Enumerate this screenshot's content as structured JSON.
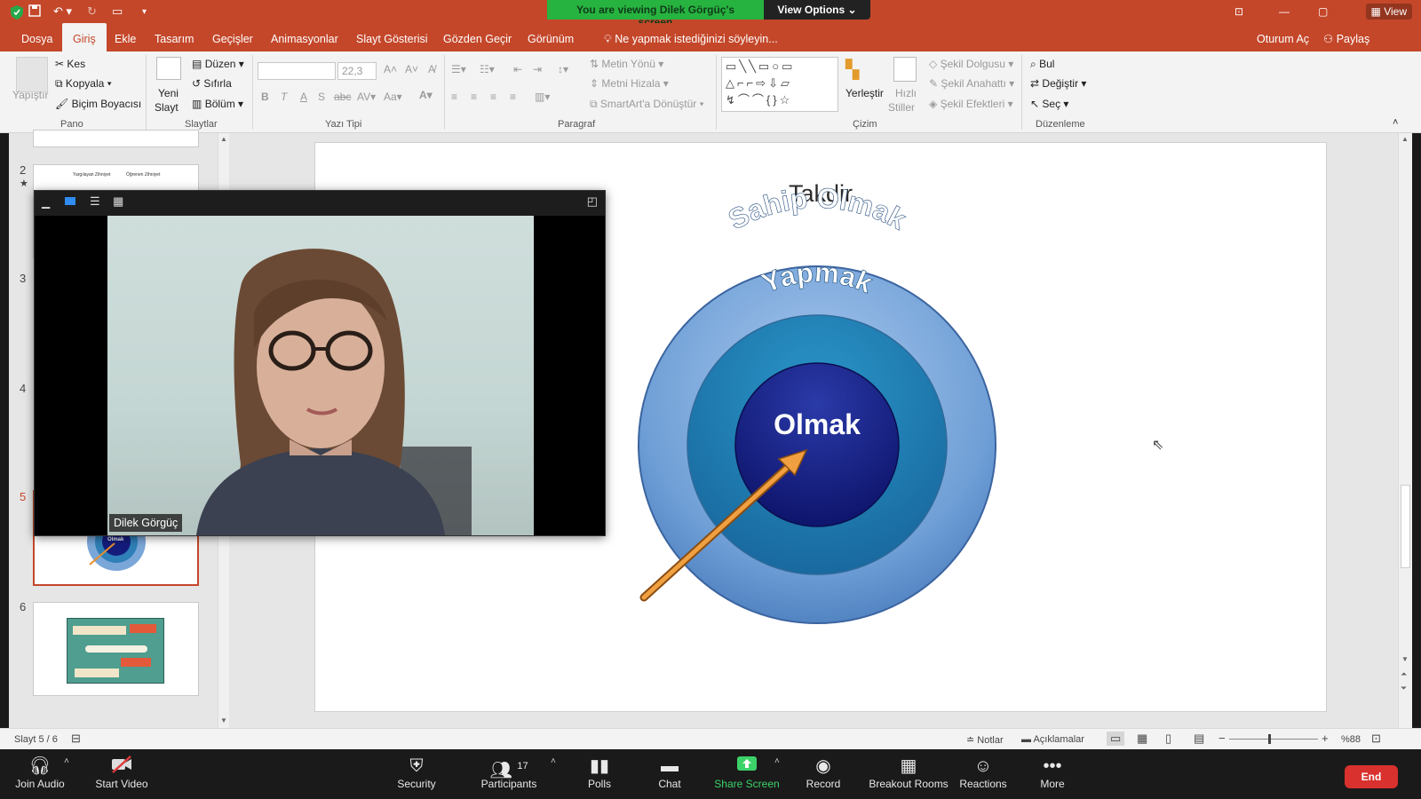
{
  "title_bar": {
    "banner_text": "You are viewing Dilek Görgüç's screen",
    "view_options": "View Options",
    "view_label": "View"
  },
  "tabs": [
    "Dosya",
    "Giriş",
    "Ekle",
    "Tasarım",
    "Geçişler",
    "Animasyonlar",
    "Slayt Gösterisi",
    "Gözden Geçir",
    "Görünüm"
  ],
  "active_tab": "Giriş",
  "tell_me": "Ne yapmak istediğinizi söyleyin...",
  "account": {
    "sign_in": "Oturum Aç",
    "share": "Paylaş"
  },
  "ribbon": {
    "paste": "Yapıştır",
    "cut": "Kes",
    "copy": "Kopyala",
    "format_painter": "Biçim Boyacısı",
    "new_slide_1": "Yeni",
    "new_slide_2": "Slayt",
    "layout": "Düzen",
    "reset": "Sıfırla",
    "section": "Bölüm",
    "font_size": "22,3",
    "text_direction": "Metin Yönü",
    "align_text": "Metni Hizala",
    "smartart": "SmartArt'a Dönüştür",
    "arrange": "Yerleştir",
    "quick_styles_1": "Hızlı",
    "quick_styles_2": "Stiller",
    "shape_fill": "Şekil Dolgusu",
    "shape_outline": "Şekil Anahattı",
    "shape_effects": "Şekil Efektleri",
    "find": "Bul",
    "replace": "Değiştir",
    "select": "Seç",
    "groups": {
      "clipboard": "Pano",
      "slides": "Slaytlar",
      "font": "Yazı Tipi",
      "paragraph": "Paragraf",
      "drawing": "Çizim",
      "editing": "Düzenleme"
    }
  },
  "thumbnails": {
    "numbers": [
      "2",
      "3",
      "4",
      "5",
      "6"
    ],
    "t2_left": "Yargılayan Zihniyet",
    "t2_right": "Öğrenen Zihniyet",
    "t5_center": "Olmak"
  },
  "slide": {
    "title": "Takdir",
    "outer": "Sahip Olmak",
    "middle": "Yapmak",
    "inner": "Olmak"
  },
  "video": {
    "participant_name": "Dilek Görgüç"
  },
  "status": {
    "slide_count": "Slayt 5 / 6",
    "notes": "Notlar",
    "comments": "Açıklamalar",
    "zoom": "%88"
  },
  "zoom_toolbar": {
    "join_audio": "Join Audio",
    "start_video": "Start Video",
    "security": "Security",
    "participants": "Participants",
    "participant_count": "17",
    "polls": "Polls",
    "chat": "Chat",
    "share_screen": "Share Screen",
    "record": "Record",
    "breakout_rooms": "Breakout Rooms",
    "reactions": "Reactions",
    "more": "More",
    "end": "End"
  },
  "colors": {
    "office_accent": "#c4472a",
    "zoom_green": "#27b33f",
    "end_red": "#d8312e"
  }
}
